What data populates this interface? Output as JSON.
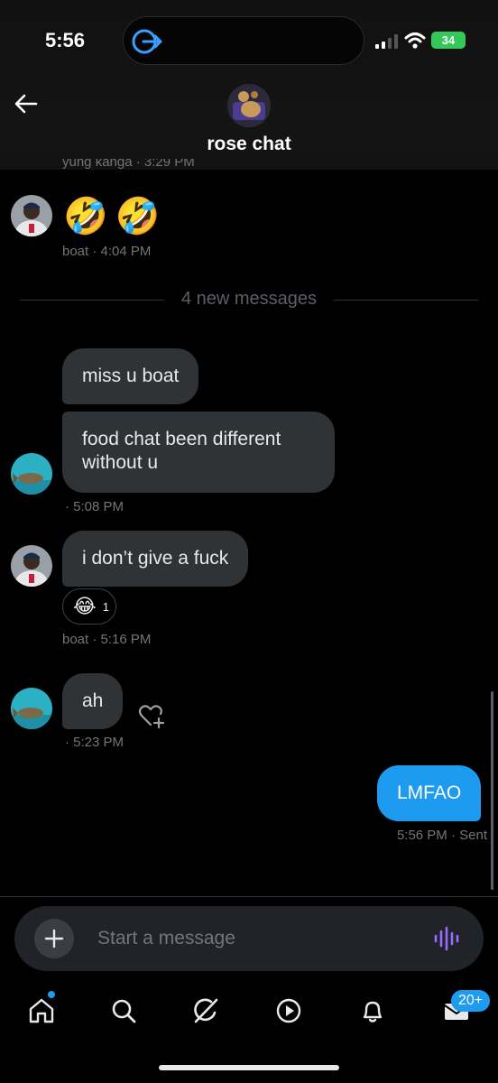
{
  "status_bar": {
    "time": "5:56",
    "battery": "34"
  },
  "header": {
    "title": "rose chat",
    "peek_meta": "yung kanga · 3:29 PM"
  },
  "messages": {
    "m1": {
      "emojis": "🤣🤣",
      "meta": "boat · 4:04 PM"
    },
    "divider": "4 new messages",
    "m2": {
      "text": "miss u boat"
    },
    "m3": {
      "text": "food chat been different without u",
      "meta": "· 5:08 PM"
    },
    "m4": {
      "text": "i don’t give a fuck",
      "reaction_emoji": "😂",
      "reaction_count": "1",
      "meta": "boat · 5:16 PM"
    },
    "m5": {
      "text": "ah",
      "meta": "· 5:23 PM"
    },
    "m6": {
      "text": "LMFAO",
      "meta": "5:56 PM · Sent"
    }
  },
  "composer": {
    "placeholder": "Start a message"
  },
  "nav": {
    "messages_badge": "20+"
  },
  "icons": {
    "back": "back-arrow-icon",
    "add": "plus-icon",
    "voice": "voice-wave-icon",
    "home": "home-icon",
    "search": "search-icon",
    "grok": "grok-icon",
    "video": "play-icon",
    "notifications": "bell-icon",
    "messages": "envelope-icon"
  },
  "colors": {
    "accent": "#1d9bf0",
    "bubble_received": "#2f3336",
    "voice": "#9b6bff",
    "battery": "#34c759"
  }
}
